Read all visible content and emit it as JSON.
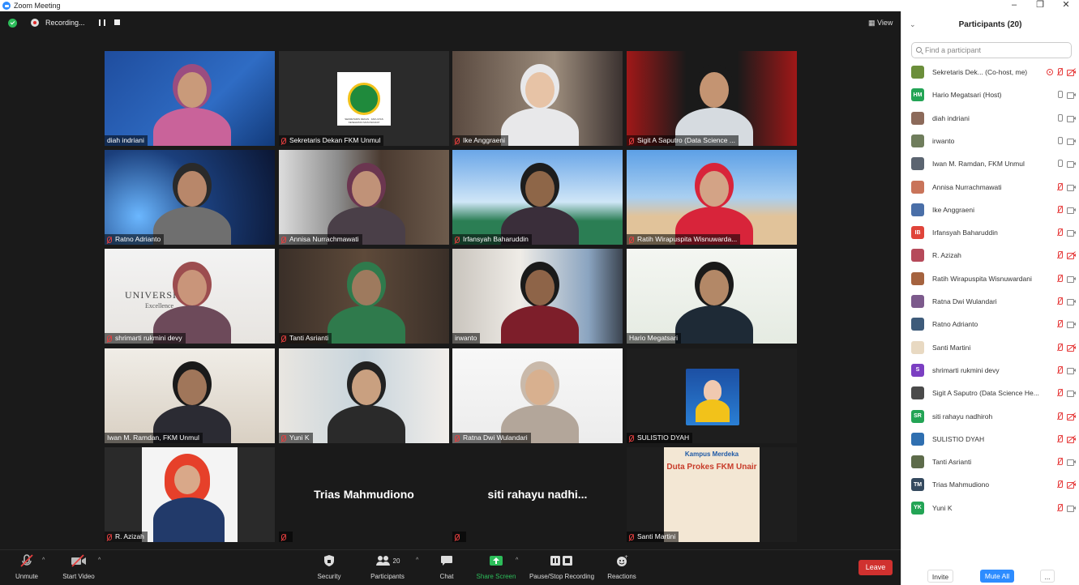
{
  "window": {
    "title": "Zoom Meeting",
    "minimize": "–",
    "restore": "❐",
    "close": "✕"
  },
  "topbar": {
    "recording_label": "Recording...",
    "view_label": "View"
  },
  "tiles": [
    {
      "name": "diah indriani",
      "muted": false
    },
    {
      "name": "Sekretaris Dekan FKM Unmul",
      "muted": true,
      "logo_text": "SEKRETARIS DEKAN · FAKULTAS KESEHATAN MASYARAKAT"
    },
    {
      "name": "Ike Anggraeni",
      "muted": true
    },
    {
      "name": "Sigit A Saputro (Data Science ...",
      "muted": true
    },
    {
      "name": "Ratno Adrianto",
      "muted": true
    },
    {
      "name": "Annisa Nurrachmawati",
      "muted": true
    },
    {
      "name": "Irfansyah Baharuddin",
      "muted": true
    },
    {
      "name": "Ratih Wirapuspita Wisnuwarda...",
      "muted": true
    },
    {
      "name": "shrimarti rukmini devy",
      "muted": true,
      "bg_text": "UNIVERSITAS",
      "bg_sub": "Excellence"
    },
    {
      "name": "Tanti Asrianti",
      "muted": true
    },
    {
      "name": "irwanto",
      "muted": false
    },
    {
      "name": "Hario Megatsari",
      "muted": false,
      "highlight": true
    },
    {
      "name": "Iwan M. Ramdan, FKM Unmul",
      "muted": false
    },
    {
      "name": "Yuni K",
      "muted": true
    },
    {
      "name": "Ratna Dwi Wulandari",
      "muted": true
    },
    {
      "name": "SULISTIO DYAH",
      "muted": true
    },
    {
      "name": "R. Azizah",
      "muted": true
    },
    {
      "name": "",
      "muted": true,
      "big_name": "Trias Mahmudiono"
    },
    {
      "name": "",
      "muted": true,
      "big_name": "siti rahayu nadhi..."
    },
    {
      "name": "Santi Martini",
      "muted": true,
      "bg_text": "Duta Prokes FKM Unair",
      "bg_sub": "Kampus Merdeka"
    }
  ],
  "toolbar": {
    "unmute": "Unmute",
    "start_video": "Start Video",
    "security": "Security",
    "participants": "Participants",
    "participants_count": "20",
    "chat": "Chat",
    "share_screen": "Share Screen",
    "pause_stop_recording": "Pause/Stop Recording",
    "reactions": "Reactions",
    "leave": "Leave"
  },
  "panel": {
    "title": "Participants (20)",
    "search_placeholder": "Find a participant",
    "participants": [
      {
        "initials": "",
        "color": "#6b8e3a",
        "name": "Sekretaris Dek... (Co-host, me)",
        "mic": "off",
        "cam": "off",
        "rec": true
      },
      {
        "initials": "HM",
        "color": "#23a455",
        "name": "Hario Megatsari (Host)",
        "mic": "on",
        "cam": "on"
      },
      {
        "initials": "",
        "color": "#8c6a5a",
        "name": "diah indriani",
        "mic": "on",
        "cam": "on"
      },
      {
        "initials": "",
        "color": "#6f7d5c",
        "name": "irwanto",
        "mic": "on",
        "cam": "on"
      },
      {
        "initials": "",
        "color": "#5b6470",
        "name": "Iwan M. Ramdan, FKM Unmul",
        "mic": "on",
        "cam": "on"
      },
      {
        "initials": "",
        "color": "#c9745a",
        "name": "Annisa Nurrachmawati",
        "mic": "off",
        "cam": "on"
      },
      {
        "initials": "",
        "color": "#4a6fa8",
        "name": "Ike Anggraeni",
        "mic": "off",
        "cam": "on"
      },
      {
        "initials": "IB",
        "color": "#e0443a",
        "name": "Irfansyah Baharuddin",
        "mic": "off",
        "cam": "on"
      },
      {
        "initials": "",
        "color": "#b64a5a",
        "name": "R. Azizah",
        "mic": "off",
        "cam": "off"
      },
      {
        "initials": "",
        "color": "#a5633f",
        "name": "Ratih Wirapuspita Wisnuwardani",
        "mic": "off",
        "cam": "on"
      },
      {
        "initials": "",
        "color": "#7c5a8c",
        "name": "Ratna Dwi Wulandari",
        "mic": "off",
        "cam": "on"
      },
      {
        "initials": "",
        "color": "#3e5b7a",
        "name": "Ratno Adrianto",
        "mic": "off",
        "cam": "on"
      },
      {
        "initials": "",
        "color": "#e8d9c2",
        "name": "Santi Martini",
        "mic": "off",
        "cam": "off"
      },
      {
        "initials": "S",
        "color": "#7b3fc2",
        "name": "shrimarti rukmini devy",
        "mic": "off",
        "cam": "on"
      },
      {
        "initials": "",
        "color": "#4a4a4a",
        "name": "Sigit A Saputro (Data Science He...",
        "mic": "off",
        "cam": "on"
      },
      {
        "initials": "SR",
        "color": "#23a455",
        "name": "siti rahayu nadhiroh",
        "mic": "off",
        "cam": "off"
      },
      {
        "initials": "",
        "color": "#2f6fb0",
        "name": "SULISTIO DYAH",
        "mic": "off",
        "cam": "off"
      },
      {
        "initials": "",
        "color": "#5d6b4a",
        "name": "Tanti Asrianti",
        "mic": "off",
        "cam": "on"
      },
      {
        "initials": "TM",
        "color": "#34495e",
        "name": "Trias Mahmudiono",
        "mic": "off",
        "cam": "off"
      },
      {
        "initials": "YK",
        "color": "#23a455",
        "name": "Yuni K",
        "mic": "off",
        "cam": "on"
      }
    ],
    "invite": "Invite",
    "mute_all": "Mute All",
    "more": "..."
  },
  "colors": {
    "accent": "#2d8cff",
    "leave": "#d0312f",
    "muted": "#e63f3f",
    "active_speaker": "#e3d83a",
    "share_green": "#2dbd5a"
  }
}
